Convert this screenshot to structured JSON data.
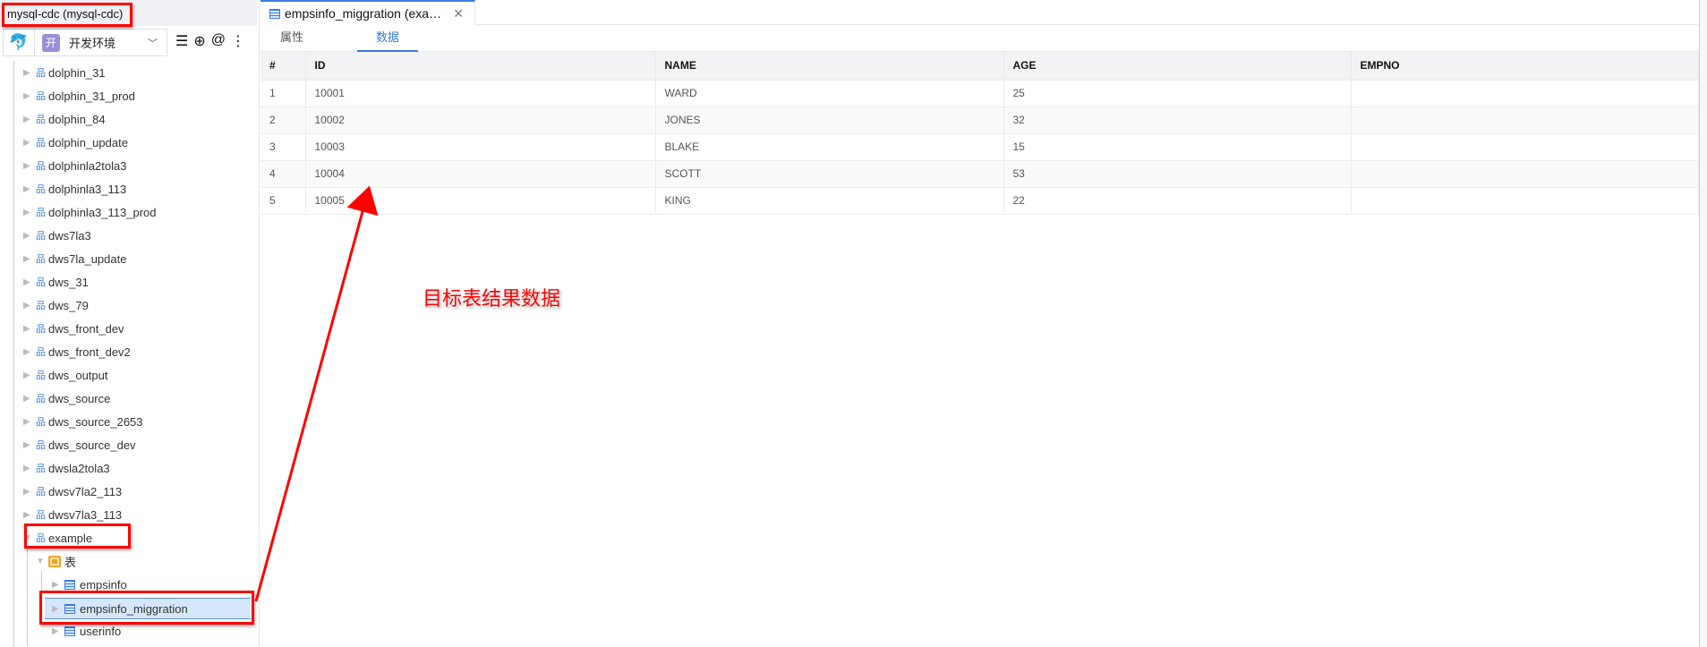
{
  "sidebar": {
    "connection_title": "mysql-cdc  (mysql-cdc)",
    "env_badge": "开",
    "env_label": "开发环境",
    "databases": [
      "dolphin_31",
      "dolphin_31_prod",
      "dolphin_84",
      "dolphin_update",
      "dolphinla2tola3",
      "dolphinla3_113",
      "dolphinla3_113_prod",
      "dws7la3",
      "dws7la_update",
      "dws_31",
      "dws_79",
      "dws_front_dev",
      "dws_front_dev2",
      "dws_output",
      "dws_source",
      "dws_source_2653",
      "dws_source_dev",
      "dwsla2tola3",
      "dwsv7la2_113",
      "dwsv7la3_113"
    ],
    "expanded_db": "example",
    "folder": "表",
    "tables": [
      "empsinfo",
      "empsinfo_miggration",
      "userinfo"
    ],
    "selected_table": "empsinfo_miggration"
  },
  "main": {
    "tab_title": "empsinfo_miggration (exa…",
    "subtabs": [
      "属性",
      "数据"
    ],
    "active_subtab": "数据",
    "columns": [
      "#",
      "ID",
      "NAME",
      "AGE",
      "EMPNO"
    ],
    "rows": [
      [
        "1",
        "10001",
        "WARD",
        "25",
        ""
      ],
      [
        "2",
        "10002",
        "JONES",
        "32",
        ""
      ],
      [
        "3",
        "10003",
        "BLAKE",
        "15",
        ""
      ],
      [
        "4",
        "10004",
        "SCOTT",
        "53",
        ""
      ],
      [
        "5",
        "10005",
        "KING",
        "22",
        ""
      ]
    ]
  },
  "annotation": {
    "text": "目标表结果数据",
    "color": "#ff0000"
  },
  "colors": {
    "accent": "#3c7de0",
    "highlight": "#ff0000"
  }
}
